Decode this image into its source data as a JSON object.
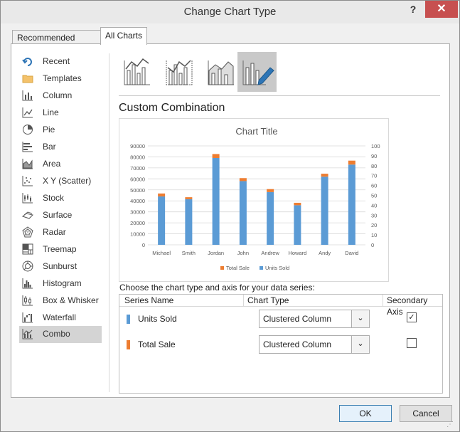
{
  "window": {
    "title": "Change Chart Type",
    "help": "?",
    "close": "✕"
  },
  "tabs": [
    {
      "label": "Recommended Charts",
      "active": false
    },
    {
      "label": "All Charts",
      "active": true
    }
  ],
  "sidebar": {
    "items": [
      {
        "label": "Recent",
        "icon": "recent-icon"
      },
      {
        "label": "Templates",
        "icon": "templates-folder-icon"
      },
      {
        "label": "Column",
        "icon": "column-chart-icon"
      },
      {
        "label": "Line",
        "icon": "line-chart-icon"
      },
      {
        "label": "Pie",
        "icon": "pie-chart-icon"
      },
      {
        "label": "Bar",
        "icon": "bar-chart-icon"
      },
      {
        "label": "Area",
        "icon": "area-chart-icon"
      },
      {
        "label": "X Y (Scatter)",
        "icon": "scatter-chart-icon"
      },
      {
        "label": "Stock",
        "icon": "stock-chart-icon"
      },
      {
        "label": "Surface",
        "icon": "surface-chart-icon"
      },
      {
        "label": "Radar",
        "icon": "radar-chart-icon"
      },
      {
        "label": "Treemap",
        "icon": "treemap-chart-icon"
      },
      {
        "label": "Sunburst",
        "icon": "sunburst-chart-icon"
      },
      {
        "label": "Histogram",
        "icon": "histogram-chart-icon"
      },
      {
        "label": "Box & Whisker",
        "icon": "box-whisker-chart-icon"
      },
      {
        "label": "Waterfall",
        "icon": "waterfall-chart-icon"
      },
      {
        "label": "Combo",
        "icon": "combo-chart-icon"
      }
    ],
    "selected": "Combo"
  },
  "subtypes": {
    "items": [
      "clustered-column-line-icon",
      "clustered-column-line-secondary-icon",
      "stacked-area-clustered-column-icon",
      "custom-combination-icon"
    ],
    "selected_index": 3
  },
  "section_title": "Custom Combination",
  "chart_data": {
    "type": "bar",
    "title": "Chart Title",
    "categories": [
      "Michael",
      "Smith",
      "Jordan",
      "John",
      "Andrew",
      "Howard",
      "Andy",
      "David"
    ],
    "series": [
      {
        "name": "Units Sold",
        "values": [
          44000,
          41500,
          79000,
          58000,
          48000,
          36000,
          62000,
          73000
        ],
        "axis": "primary"
      },
      {
        "name": "Total Sale",
        "values": [
          3,
          2,
          4,
          3,
          3,
          2.5,
          3,
          4
        ],
        "axis": "secondary",
        "stacked_on_top": true
      }
    ],
    "y_left": {
      "min": 0,
      "max": 90000,
      "ticks": [
        "0",
        "10000",
        "20000",
        "30000",
        "40000",
        "50000",
        "60000",
        "70000",
        "80000",
        "90000"
      ]
    },
    "y_right": {
      "min": 0,
      "max": 100,
      "ticks": [
        "0",
        "10",
        "20",
        "30",
        "40",
        "50",
        "60",
        "70",
        "80",
        "90",
        "100"
      ]
    },
    "legend": {
      "position": "bottom",
      "entries": [
        "Total Sale",
        "Units Sold"
      ]
    },
    "colors": {
      "Units Sold": "#5b9bd5",
      "Total Sale": "#ed7d31",
      "grid": "#d9d9d9"
    },
    "grid": true
  },
  "series_config": {
    "prompt": "Choose the chart type and axis for your data series:",
    "headers": {
      "name": "Series Name",
      "type": "Chart Type",
      "axis": "Secondary Axis"
    },
    "rows": [
      {
        "name": "Units Sold",
        "color": "#5b9bd5",
        "chart_type": "Clustered Column",
        "secondary": true,
        "check": "✓"
      },
      {
        "name": "Total Sale",
        "color": "#ed7d31",
        "chart_type": "Clustered Column",
        "secondary": false,
        "check": ""
      }
    ]
  },
  "buttons": {
    "ok": "OK",
    "cancel": "Cancel"
  }
}
